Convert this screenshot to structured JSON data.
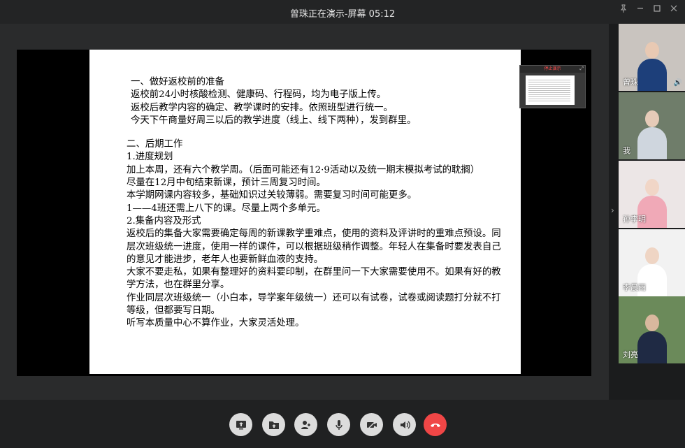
{
  "window": {
    "title": "曾珠正在演示-屏幕 05:12",
    "controls": [
      "pin-icon",
      "minimize-icon",
      "maximize-icon",
      "close-icon"
    ]
  },
  "slide": {
    "lines": [
      {
        "text": "一、做好返校前的准备",
        "indent": true
      },
      {
        "text": "返校前24小时核酸检测、健康码、行程码，均为电子版上传。",
        "indent": true
      },
      {
        "text": "返校后教学内容的确定、教学课时的安排。依照班型进行统一。",
        "indent": true
      },
      {
        "text": "今天下午商量好周三以后的教学进度（线上、线下两种），发到群里。",
        "indent": true
      },
      {
        "text": "",
        "gap": true
      },
      {
        "text": "二、后期工作"
      },
      {
        "text": "1.进度规划"
      },
      {
        "text": "加上本周，还有六个教学周。（后面可能还有12·9活动以及统一期末模拟考试的耽搁）"
      },
      {
        "text": "尽量在12月中旬结束新课，预计三周复习时间。"
      },
      {
        "text": "本学期网课内容较多，基础知识过关较薄弱。需要复习时间可能更多。"
      },
      {
        "text": "1——4班还需上八下的课。尽量上两个多单元。"
      },
      {
        "text": "2.集备内容及形式"
      },
      {
        "text": "返校后的集备大家需要确定每周的新课教学重难点，使用的资料及评讲时的重难点预设。同层次班级统一进度，使用一样的课件，可以根据班级稍作调整。年轻人在集备时要发表自己的意见才能进步，老年人也要新鲜血液的支持。"
      },
      {
        "text": "大家不要走私，如果有整理好的资料要印制，在群里问一下大家需要使用不。如果有好的教学方法，也在群里分享。"
      },
      {
        "text": "作业同层次班级统一（小白本，导学案年级统一）还可以有试卷，试卷或阅读题打分就不打等级，但都要写日期。"
      },
      {
        "text": "听写本质量中心不算作业，大家灵活处理。"
      }
    ]
  },
  "mini_preview": {
    "header": "停止演示"
  },
  "participants": [
    {
      "name": "曾珠",
      "speaking": true,
      "bg": "#c9c4bf",
      "skin": "#e8c9b3",
      "cloth": "#1d3f7a"
    },
    {
      "name": "我",
      "speaking": false,
      "bg": "#6f7d6a",
      "skin": "#e6cbb8",
      "cloth": "#cfd6de"
    },
    {
      "name": "孙李玥",
      "speaking": false,
      "bg": "#ece6e6",
      "skin": "#f1d6c7",
      "cloth": "#f0a9b7"
    },
    {
      "name": "李晨雨",
      "speaking": false,
      "bg": "#f2f2f2",
      "skin": "#efd5c4",
      "cloth": "#ffffff"
    },
    {
      "name": "刘亮",
      "speaking": false,
      "bg": "#6b8a5a",
      "skin": "#d9b89e",
      "cloth": "#1f2a44"
    }
  ],
  "toolbar": {
    "buttons": [
      "share-screen-button",
      "share-file-button",
      "invite-button",
      "microphone-button",
      "camera-off-button",
      "speaker-button",
      "hang-up-button"
    ]
  }
}
